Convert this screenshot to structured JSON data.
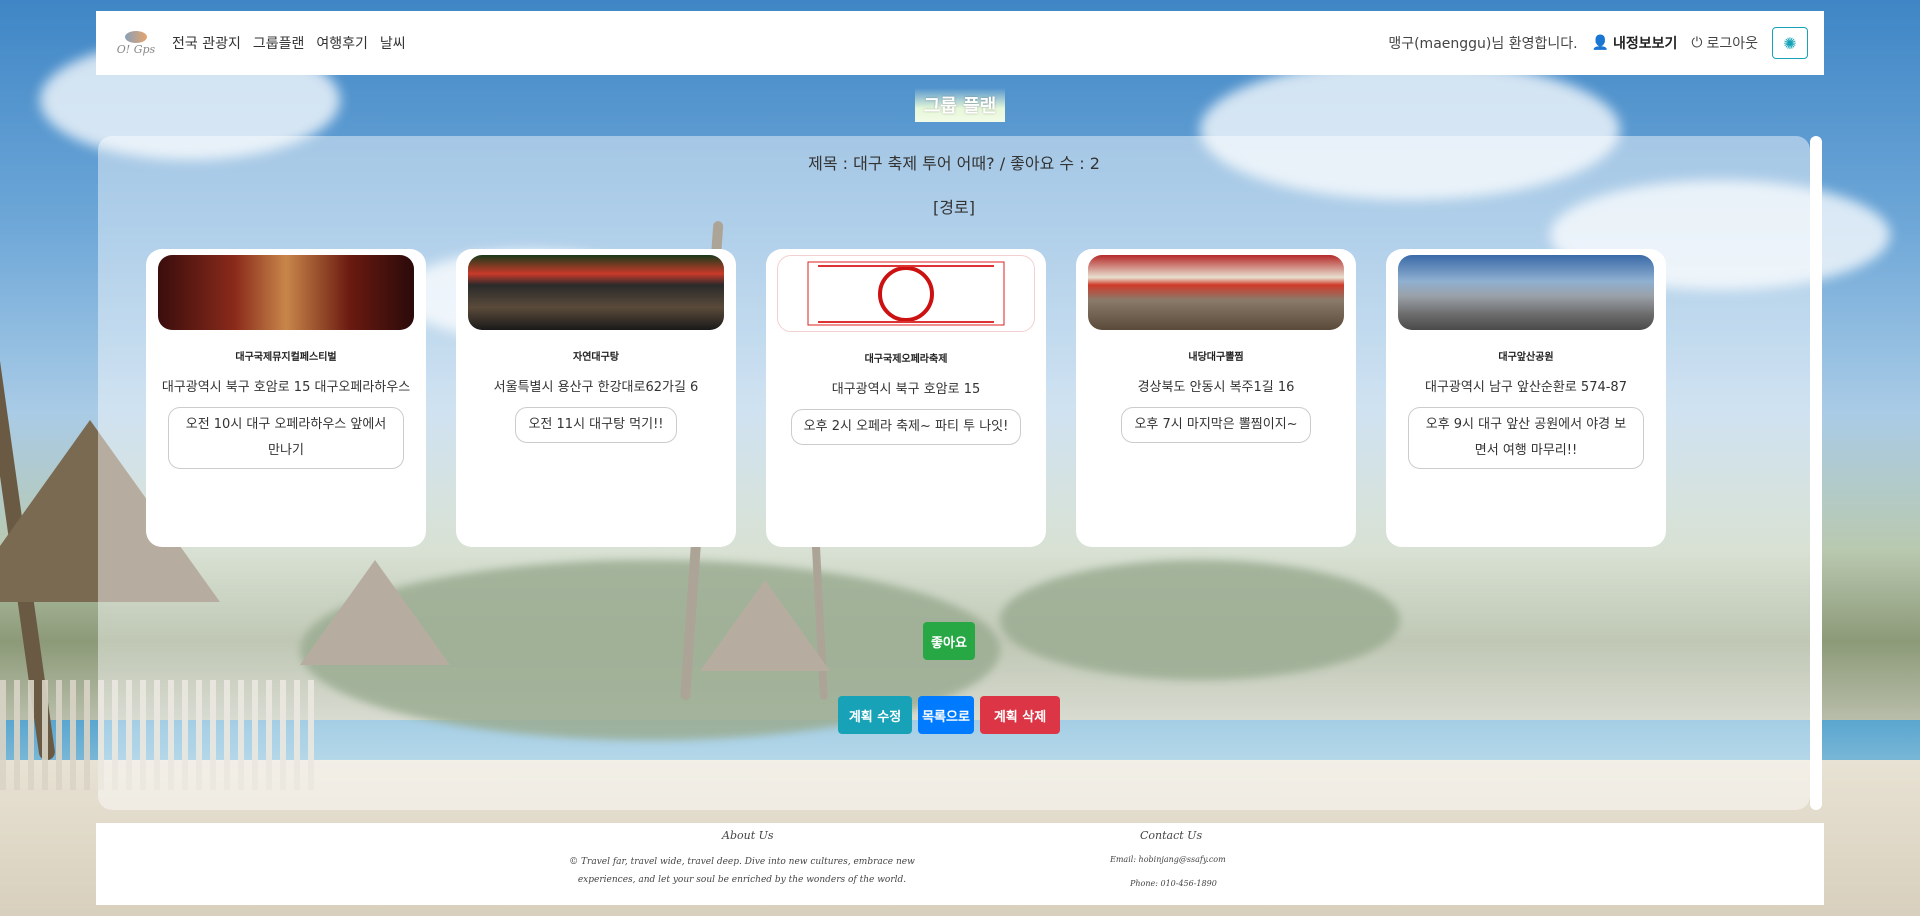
{
  "navbar": {
    "logo_text": "O! Gps",
    "links": [
      "전국 관광지",
      "그룹플랜",
      "여행후기",
      "날씨"
    ],
    "welcome": "맹구(maenggu)님 환영합니다.",
    "mypage": "내정보보기",
    "logout": "로그아웃"
  },
  "page_title": "그룹 플랜",
  "plan": {
    "header": "제목 : 대구 축제 투어 어때? / 좋아요 수 : 2",
    "route_label": "[경로]"
  },
  "cards": [
    {
      "name": "대구국제뮤지컬페스티벌",
      "address": "대구광역시 북구 호암로 15 대구오페라하우스",
      "memo": "오전 10시 대구 오페라하우스 앞에서 만나기"
    },
    {
      "name": "자연대구탕",
      "address": "서울특별시 용산구 한강대로62가길 6",
      "memo": "오전 11시 대구탕 먹기!!"
    },
    {
      "name": "대구국제오페라축제",
      "address": "대구광역시 북구 호암로 15",
      "memo": "오후 2시 오페라 축제~ 파티 투 나잇!"
    },
    {
      "name": "내당대구뽈찜",
      "address": "경상북도 안동시 복주1길 16",
      "memo": "오후 7시 마지막은 뽈찜이지~"
    },
    {
      "name": "대구앞산공원",
      "address": "대구광역시 남구 앞산순환로 574-87",
      "memo": "오후 9시 대구 앞산 공원에서 야경 보면서 여행 마무리!!"
    }
  ],
  "buttons": {
    "like": "좋아요",
    "edit": "계획 수정",
    "list": "목록으로",
    "delete": "계획 삭제"
  },
  "footer": {
    "about_title": "About Us",
    "about_text": "© Travel far, travel wide, travel deep. Dive into new cultures, embrace new experiences, and let your soul be enriched by the wonders of the world.",
    "contact_title": "Contact Us",
    "email": "Email: hobinjang@ssafy.com",
    "phone": "Phone: 010-456-1890"
  },
  "colors": {
    "like": "#28a745",
    "edit": "#17a2b8",
    "list": "#007bff",
    "delete": "#dc3545"
  }
}
